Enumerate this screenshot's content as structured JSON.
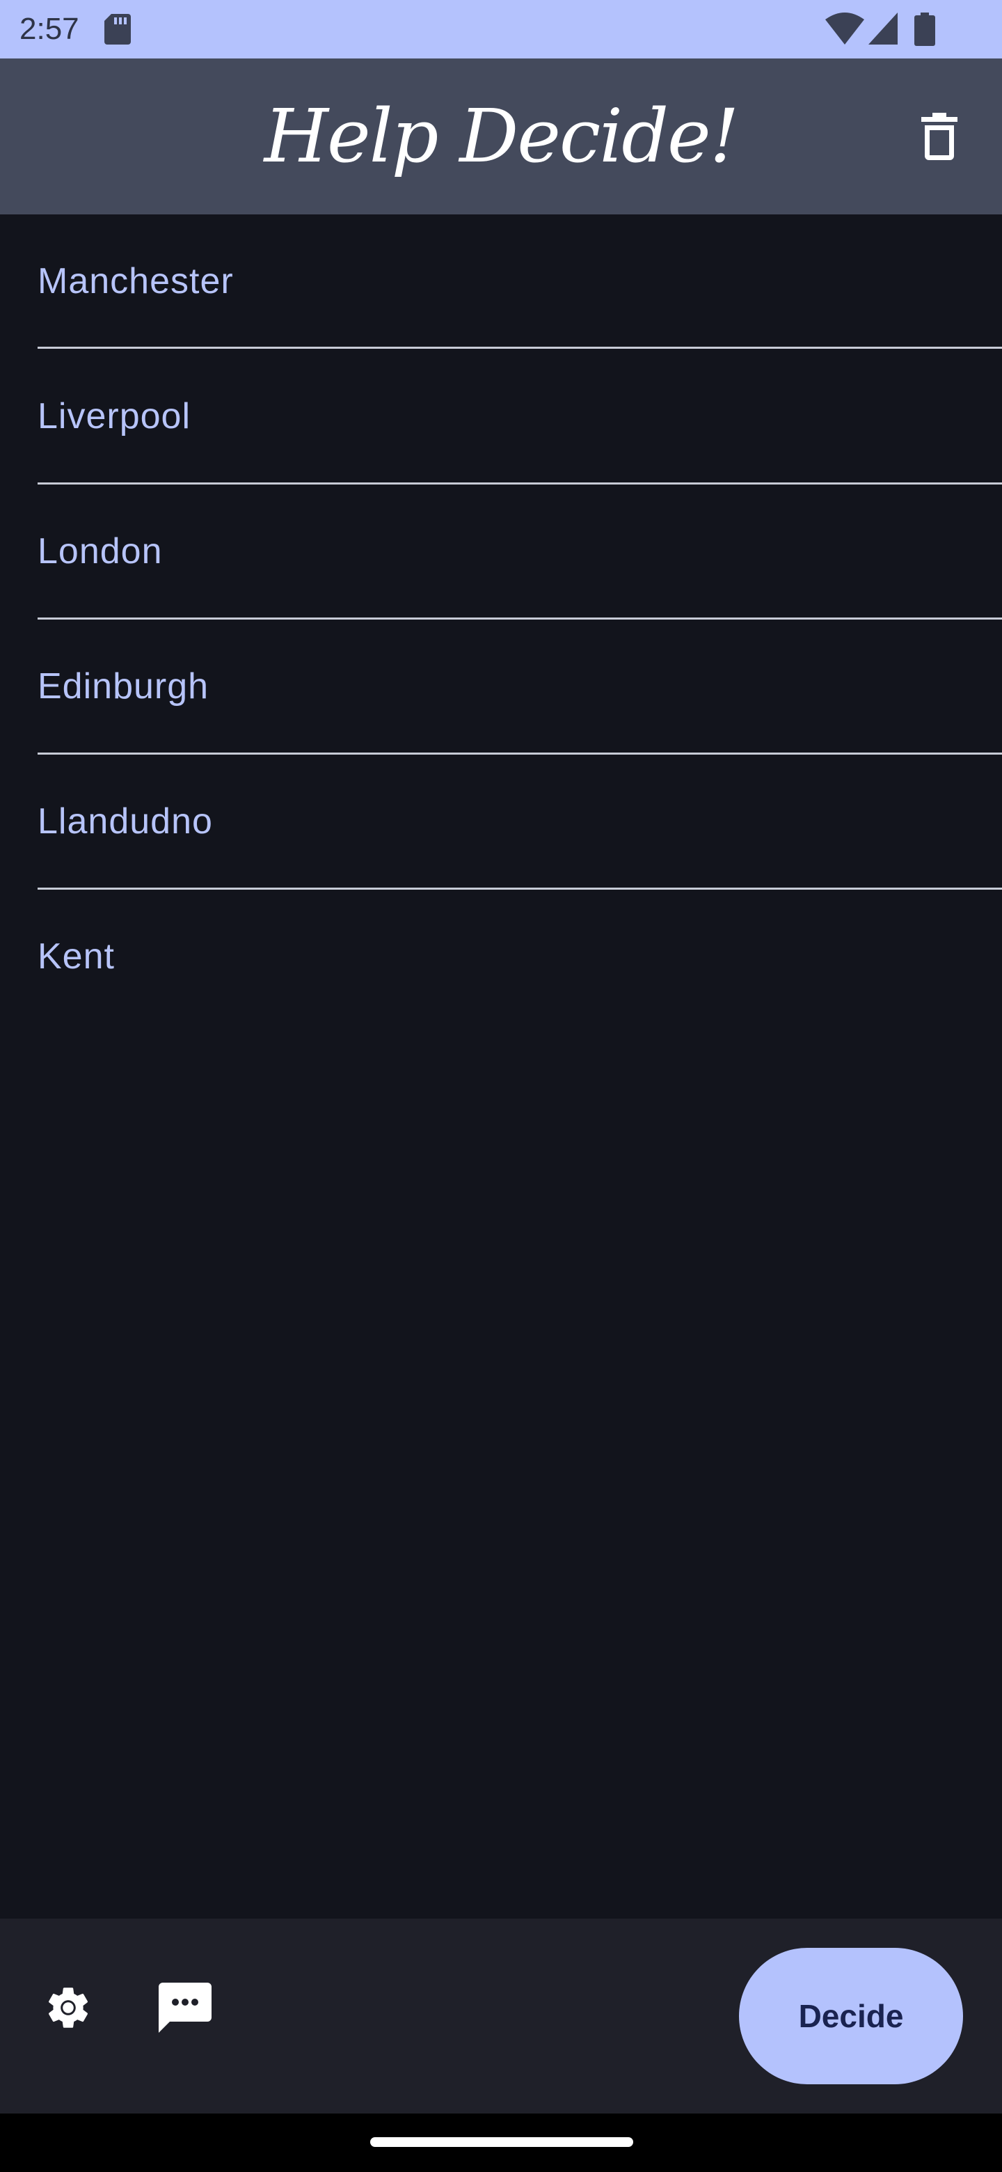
{
  "status_bar": {
    "time": "2:57",
    "icons": [
      "sd-card-icon",
      "wifi-icon",
      "cell-signal-icon",
      "battery-icon"
    ]
  },
  "app_bar": {
    "title": "Help Decide!",
    "actions": [
      "delete-icon"
    ]
  },
  "list": {
    "items": [
      {
        "label": "Manchester"
      },
      {
        "label": "Liverpool"
      },
      {
        "label": "London"
      },
      {
        "label": "Edinburgh"
      },
      {
        "label": "Llandudno"
      },
      {
        "label": "Kent"
      }
    ]
  },
  "bottom_bar": {
    "icons": [
      "settings-icon",
      "chat-icon"
    ],
    "decide_label": "Decide"
  },
  "colors": {
    "status_bar": "#b4c2fd",
    "app_bar": "#444a5c",
    "list_background": "#12141c",
    "list_text": "#b7c4f9",
    "divider": "#c7cbd6",
    "bottom_bar": "#1f2029",
    "accent": "#b4c2fd",
    "accent_text": "#1a2350"
  }
}
